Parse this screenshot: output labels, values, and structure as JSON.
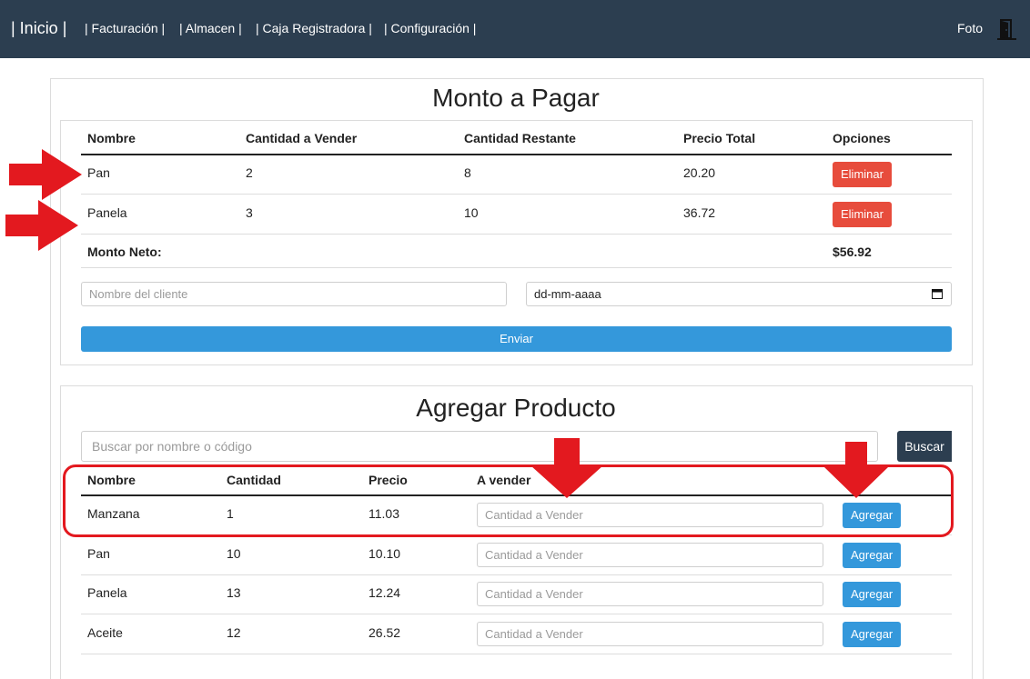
{
  "nav": {
    "brand": "| Inicio |",
    "items": [
      {
        "label": "| Facturación |"
      },
      {
        "label": "| Almacen |"
      },
      {
        "label": "| Caja Registradora |"
      },
      {
        "label": "| Configuración |"
      }
    ],
    "photo_label": "Foto",
    "exit_icon": "door-exit-icon"
  },
  "payment": {
    "title": "Monto a Pagar",
    "headers": {
      "name": "Nombre",
      "qty_to_sell": "Cantidad a Vender",
      "qty_remaining": "Cantidad Restante",
      "total_price": "Precio Total",
      "options": "Opciones"
    },
    "rows": [
      {
        "name": "Pan",
        "qty_to_sell": "2",
        "qty_remaining": "8",
        "total_price": "20.20",
        "action": "Eliminar"
      },
      {
        "name": "Panela",
        "qty_to_sell": "3",
        "qty_remaining": "10",
        "total_price": "36.72",
        "action": "Eliminar"
      }
    ],
    "net_label": "Monto Neto:",
    "net_value": "$56.92",
    "client_placeholder": "Nombre del cliente",
    "date_placeholder": "dd-mm-aaaa",
    "submit_label": "Enviar"
  },
  "products": {
    "title": "Agregar Producto",
    "search_placeholder": "Buscar por nombre o código",
    "search_button": "Buscar",
    "headers": {
      "name": "Nombre",
      "quantity": "Cantidad",
      "price": "Precio",
      "to_sell": "A vender"
    },
    "qty_placeholder": "Cantidad a Vender",
    "add_label": "Agregar",
    "rows": [
      {
        "name": "Manzana",
        "quantity": "1",
        "price": "11.03"
      },
      {
        "name": "Pan",
        "quantity": "10",
        "price": "10.10"
      },
      {
        "name": "Panela",
        "quantity": "13",
        "price": "12.24"
      },
      {
        "name": "Aceite",
        "quantity": "12",
        "price": "26.52"
      }
    ]
  },
  "annotations": {
    "arrow_color": "#e3191f"
  },
  "colors": {
    "navbar": "#2c3e50",
    "danger": "#e74c3c",
    "info": "#3498db"
  }
}
